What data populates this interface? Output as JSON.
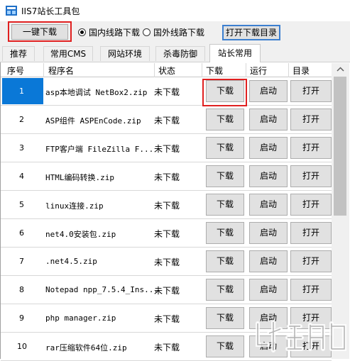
{
  "window": {
    "title": "IIS7站长工具包"
  },
  "toolbar": {
    "one_key_label": "一键下载",
    "radio_domestic": "国内线路下载",
    "radio_foreign": "国外线路下载",
    "open_dir_label": "打开下载目录"
  },
  "tabs": [
    {
      "label": "推荐",
      "active": false
    },
    {
      "label": "常用CMS",
      "active": false
    },
    {
      "label": "网站环境",
      "active": false
    },
    {
      "label": "杀毒防御",
      "active": false
    },
    {
      "label": "站长常用",
      "active": true
    }
  ],
  "columns": {
    "index": "序号",
    "name": "程序名",
    "status": "状态",
    "download": "下载",
    "run": "运行",
    "dir": "目录"
  },
  "rows": [
    {
      "index": "1",
      "name": "asp本地调试 NetBox2.zip",
      "status": "未下载",
      "download": "下载",
      "run": "启动",
      "open": "打开"
    },
    {
      "index": "2",
      "name": "ASP组件 ASPEnCode.zip",
      "status": "未下载",
      "download": "下载",
      "run": "启动",
      "open": "打开"
    },
    {
      "index": "3",
      "name": "FTP客户端 FileZilla F...",
      "status": "未下载",
      "download": "下载",
      "run": "启动",
      "open": "打开"
    },
    {
      "index": "4",
      "name": "HTML编码转换.zip",
      "status": "未下载",
      "download": "下载",
      "run": "启动",
      "open": "打开"
    },
    {
      "index": "5",
      "name": "linux连接.zip",
      "status": "未下载",
      "download": "下载",
      "run": "启动",
      "open": "打开"
    },
    {
      "index": "6",
      "name": "net4.0安装包.zip",
      "status": "未下载",
      "download": "下载",
      "run": "启动",
      "open": "打开"
    },
    {
      "index": "7",
      "name": ".net4.5.zip",
      "status": "未下载",
      "download": "下载",
      "run": "启动",
      "open": "打开"
    },
    {
      "index": "8",
      "name": "Notepad npp_7.5.4_Ins...",
      "status": "未下载",
      "download": "下载",
      "run": "启动",
      "open": "打开"
    },
    {
      "index": "9",
      "name": "php manager.zip",
      "status": "未下载",
      "download": "下载",
      "run": "启动",
      "open": "打开"
    },
    {
      "index": "10",
      "name": "rar压缩软件64位.zip",
      "status": "未下载",
      "download": "下载",
      "run": "启动",
      "open": "打开"
    }
  ],
  "selected_row": "1",
  "colors": {
    "selection": "#0a78d7",
    "highlight_box": "#e02020",
    "focus_border": "#3c7fd0"
  }
}
